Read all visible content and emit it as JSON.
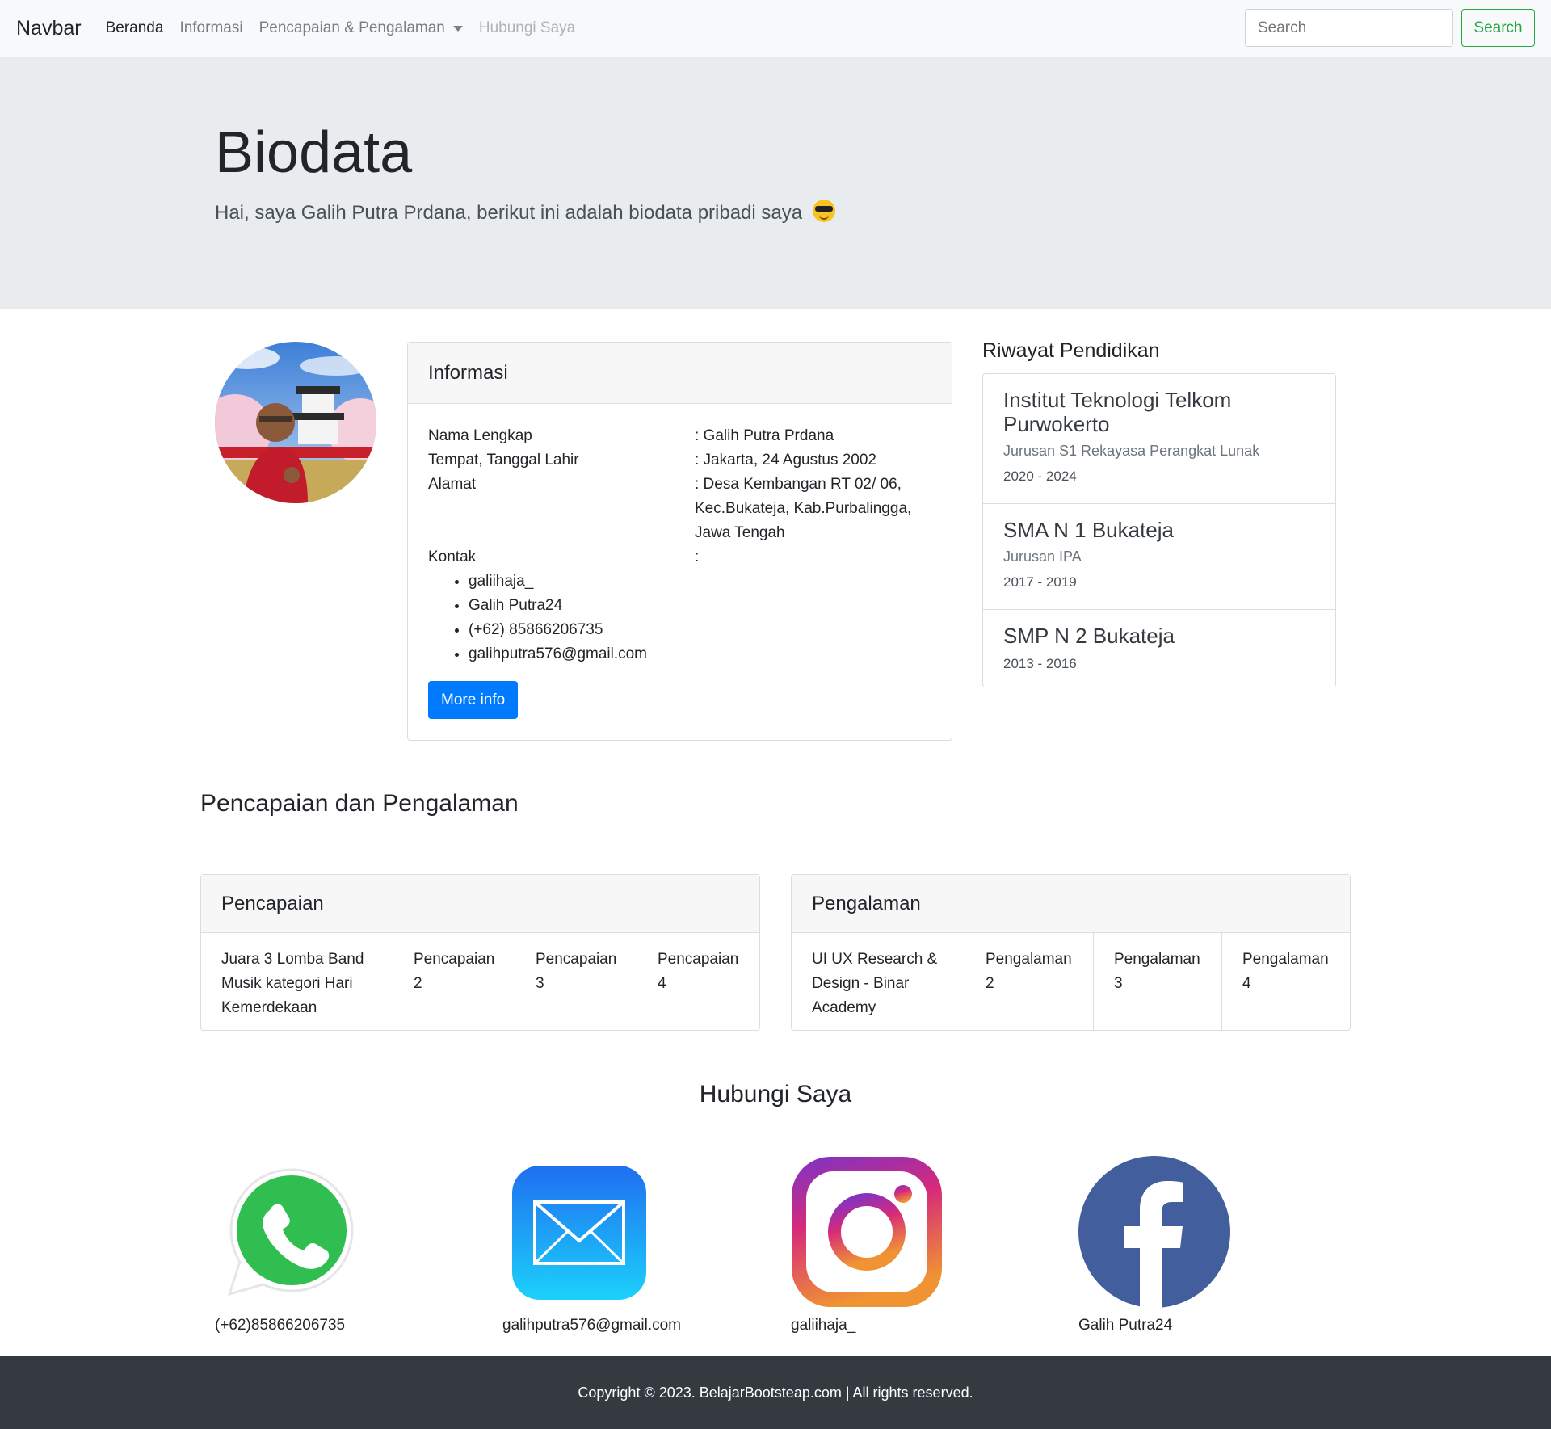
{
  "navbar": {
    "brand": "Navbar",
    "links": [
      "Beranda",
      "Informasi",
      "Pencapaian & Pengalaman",
      "Hubungi Saya"
    ],
    "search_placeholder": "Search",
    "search_button": "Search"
  },
  "hero": {
    "title": "Biodata",
    "subtitle": "Hai, saya Galih Putra Prdana, berikut ini adalah biodata pribadi saya"
  },
  "info": {
    "header": "Informasi",
    "rows": [
      {
        "label": "Nama Lengkap",
        "value": ": Galih Putra Prdana"
      },
      {
        "label": "Tempat, Tanggal Lahir",
        "value": ": Jakarta, 24 Agustus 2002"
      },
      {
        "label": "Alamat",
        "value": ": Desa Kembangan RT 02/ 06, Kec.Bukateja, Kab.Purbalingga, Jawa Tengah"
      },
      {
        "label": "Kontak",
        "value": ":"
      }
    ],
    "contacts": [
      "galiihaja_",
      "Galih Putra24",
      "(+62) 85866206735",
      "galihputra576@gmail.com"
    ],
    "more_button": "More info"
  },
  "education": {
    "title": "Riwayat Pendidikan",
    "items": [
      {
        "school": "Institut Teknologi Telkom Purwokerto",
        "major": "Jurusan S1 Rekayasa Perangkat Lunak",
        "years": "2020 - 2024"
      },
      {
        "school": "SMA N 1 Bukateja",
        "major": "Jurusan IPA",
        "years": "2017 - 2019"
      },
      {
        "school": "SMP N 2 Bukateja",
        "major": "",
        "years": "2013 - 2016"
      }
    ]
  },
  "achievements_section": {
    "title": "Pencapaian dan Pengalaman",
    "pencapaian": {
      "header": "Pencapaian",
      "cells": [
        "Juara 3 Lomba Band Musik kategori Hari Kemerdekaan",
        "Pencapaian 2",
        "Pencapaian 3",
        "Pencapaian 4"
      ]
    },
    "pengalaman": {
      "header": "Pengalaman",
      "cells": [
        "UI UX Research & Design - Binar Academy",
        "Pengalaman 2",
        "Pengalaman 3",
        "Pengalaman 4"
      ]
    }
  },
  "contact_section": {
    "title": "Hubungi Saya",
    "items": [
      {
        "icon": "whatsapp-icon",
        "label": "(+62)85866206735"
      },
      {
        "icon": "mail-icon",
        "label": "galihputra576@gmail.com"
      },
      {
        "icon": "instagram-icon",
        "label": "galiihaja_"
      },
      {
        "icon": "facebook-icon",
        "label": "Galih Putra24"
      }
    ]
  },
  "footer": {
    "text": "Copyright © 2023. BelajarBootsteap.com | All rights reserved."
  },
  "colors": {
    "primary": "#007bff",
    "success": "#28a745",
    "footer_bg": "#343a40",
    "jumbotron_bg": "#e9ecef"
  }
}
